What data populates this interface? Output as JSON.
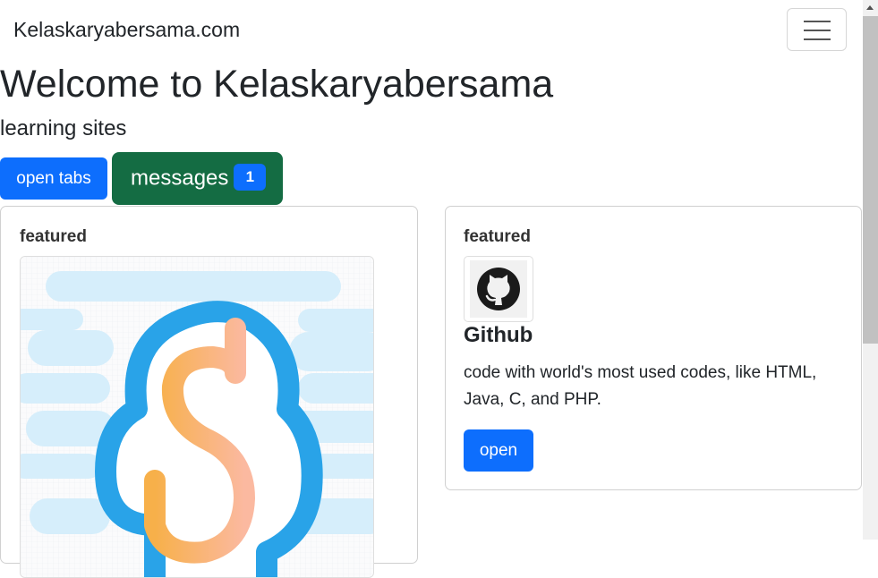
{
  "navbar": {
    "brand": "Kelaskaryabersama.com",
    "toggler_icon": "hamburger-menu-icon"
  },
  "header": {
    "title": "Welcome to Kelaskaryabersama",
    "subtitle": "learning sites"
  },
  "buttons": {
    "open_tabs": "open tabs",
    "messages": "messages",
    "messages_badge": "1"
  },
  "cards": [
    {
      "label": "featured",
      "image_icon": "kelaskaryabersama-logo-icon"
    },
    {
      "label": "featured",
      "image_icon": "github-logo-icon",
      "title": "Github",
      "text": "code with world's most used codes, like HTML, Java, C, and PHP.",
      "button": "open"
    }
  ],
  "colors": {
    "primary": "#0d6efd",
    "success": "#146c43",
    "logo_blue": "#29a3e8",
    "logo_orange": "#f7b04a"
  }
}
